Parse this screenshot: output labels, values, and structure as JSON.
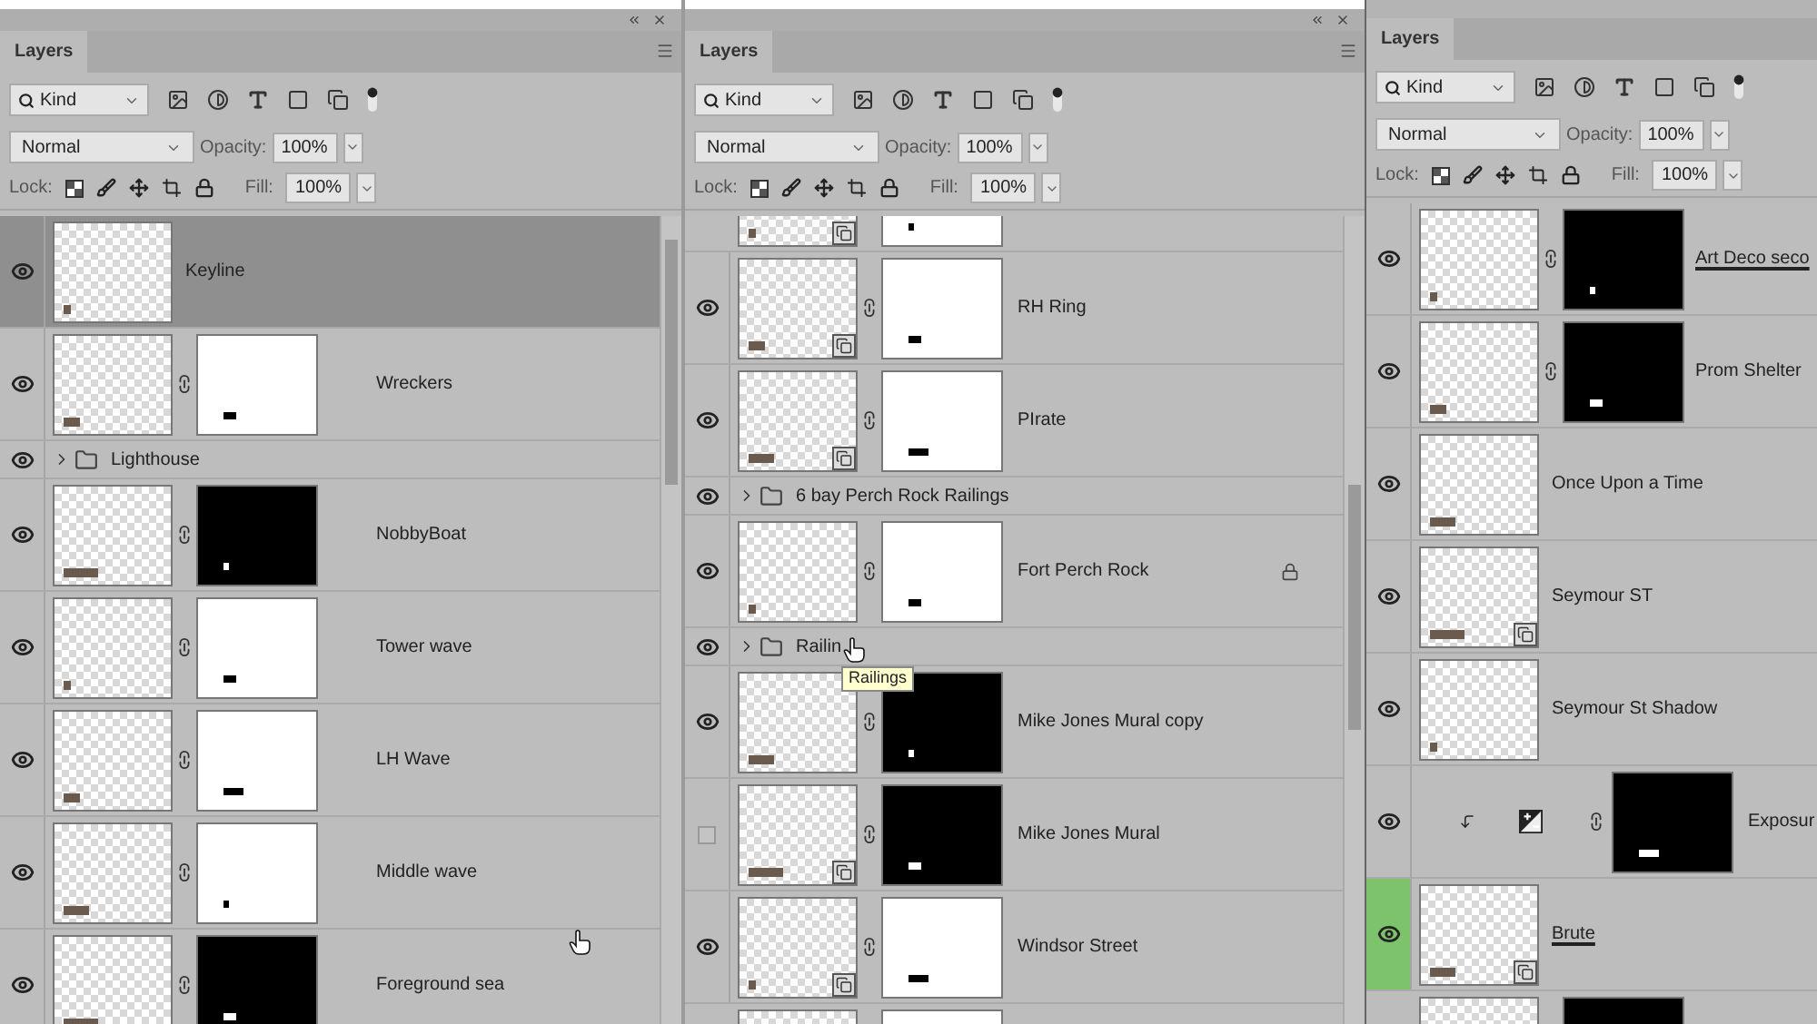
{
  "panels": [
    {
      "title_bar": true,
      "tab": "Layers",
      "filter": "Kind",
      "blend_mode": "Normal",
      "opacity_label": "Opacity:",
      "opacity": "100%",
      "lock_label": "Lock:",
      "fill_label": "Fill:",
      "fill": "100%",
      "scrollbar": true,
      "layers": [
        {
          "kind": "layer",
          "name": "Keyline",
          "visible": true,
          "selected": true,
          "mask": false,
          "smart_object": false,
          "locked": false,
          "underlined": false
        },
        {
          "kind": "layer",
          "name": "Wreckers",
          "visible": true,
          "selected": false,
          "mask": true,
          "dark_mask": false,
          "smart_object": false,
          "locked": false,
          "underlined": false
        },
        {
          "kind": "group",
          "name": "Lighthouse",
          "visible": true,
          "selected": false
        },
        {
          "kind": "layer",
          "name": "NobbyBoat",
          "visible": true,
          "selected": false,
          "mask": true,
          "dark_mask": true,
          "smart_object": false,
          "locked": false,
          "underlined": false
        },
        {
          "kind": "layer",
          "name": "Tower wave",
          "visible": true,
          "selected": false,
          "mask": true,
          "dark_mask": false,
          "smart_object": false,
          "locked": false,
          "underlined": false
        },
        {
          "kind": "layer",
          "name": "LH Wave",
          "visible": true,
          "selected": false,
          "mask": true,
          "dark_mask": false,
          "smart_object": false,
          "locked": false,
          "underlined": false
        },
        {
          "kind": "layer",
          "name": "Middle wave",
          "visible": true,
          "selected": false,
          "mask": true,
          "dark_mask": false,
          "smart_object": false,
          "locked": false,
          "underlined": false
        },
        {
          "kind": "layer",
          "name": "Foreground sea",
          "visible": true,
          "selected": false,
          "mask": true,
          "dark_mask": true,
          "smart_object": false,
          "locked": false,
          "underlined": false
        }
      ]
    },
    {
      "title_bar": true,
      "tab": "Layers",
      "filter": "Kind",
      "blend_mode": "Normal",
      "opacity_label": "Opacity:",
      "opacity": "100%",
      "lock_label": "Lock:",
      "fill_label": "Fill:",
      "fill": "100%",
      "scrollbar": true,
      "layers": [
        {
          "kind": "cut_top",
          "selected": false,
          "mask": true,
          "dark_mask": false,
          "smart_object": true
        },
        {
          "kind": "layer",
          "name": "RH Ring",
          "visible": true,
          "selected": false,
          "mask": true,
          "dark_mask": false,
          "smart_object": true,
          "locked": false,
          "underlined": false
        },
        {
          "kind": "layer",
          "name": "PIrate",
          "visible": true,
          "selected": false,
          "mask": true,
          "dark_mask": false,
          "smart_object": true,
          "locked": false,
          "underlined": false
        },
        {
          "kind": "group",
          "name": "6 bay Perch Rock Railings",
          "visible": true,
          "selected": false
        },
        {
          "kind": "layer",
          "name": "Fort Perch Rock",
          "visible": true,
          "selected": false,
          "mask": true,
          "dark_mask": false,
          "smart_object": false,
          "locked": true,
          "underlined": false
        },
        {
          "kind": "group",
          "name": "Railin",
          "visible": true,
          "selected": false
        },
        {
          "kind": "layer",
          "name": "Mike Jones Mural copy",
          "visible": true,
          "selected": false,
          "mask": true,
          "dark_mask": true,
          "smart_object": false,
          "locked": false,
          "underlined": false
        },
        {
          "kind": "layer",
          "name": "Mike Jones Mural",
          "visible": false,
          "selected": false,
          "mask": true,
          "dark_mask": true,
          "smart_object": true,
          "locked": false,
          "underlined": false
        },
        {
          "kind": "layer",
          "name": "Windsor Street",
          "visible": true,
          "selected": false,
          "mask": true,
          "dark_mask": false,
          "smart_object": true,
          "locked": false,
          "underlined": false
        },
        {
          "kind": "cut_bottom",
          "selected": false,
          "mask": true,
          "dark_mask": false
        }
      ]
    },
    {
      "title_bar": false,
      "tab": "Layers",
      "filter": "Kind",
      "blend_mode": "Normal",
      "opacity_label": "Opacity:",
      "opacity": "100%",
      "lock_label": "Lock:",
      "fill_label": "Fill:",
      "fill": "100%",
      "scrollbar": false,
      "layers": [
        {
          "kind": "layer",
          "name": "Art Deco seco",
          "visible": true,
          "selected": false,
          "mask": true,
          "dark_mask": true,
          "smart_object": false,
          "locked": false,
          "underlined": true
        },
        {
          "kind": "layer",
          "name": "Prom Shelter",
          "visible": true,
          "selected": false,
          "mask": true,
          "dark_mask": true,
          "smart_object": false,
          "locked": false,
          "underlined": false
        },
        {
          "kind": "layer",
          "name": "Once Upon a Time",
          "visible": true,
          "selected": false,
          "mask": false,
          "smart_object": false,
          "locked": false,
          "underlined": false
        },
        {
          "kind": "layer",
          "name": "Seymour ST",
          "visible": true,
          "selected": false,
          "mask": false,
          "smart_object": true,
          "locked": false,
          "underlined": false
        },
        {
          "kind": "layer",
          "name": "Seymour St Shadow",
          "visible": true,
          "selected": false,
          "mask": false,
          "smart_object": false,
          "locked": false,
          "underlined": false
        },
        {
          "kind": "adjustment",
          "name": "Exposur",
          "visible": true,
          "selected": false,
          "dark_mask": true,
          "clipped": true
        },
        {
          "kind": "layer",
          "name": "Brute",
          "visible": true,
          "selected": false,
          "color": "#7dc36b",
          "mask": false,
          "smart_object": true,
          "locked": false,
          "underlined": true
        },
        {
          "kind": "cut_bottom",
          "selected": false,
          "mask": true,
          "dark_mask": true
        }
      ]
    }
  ],
  "tooltip": {
    "text": "Railings"
  }
}
